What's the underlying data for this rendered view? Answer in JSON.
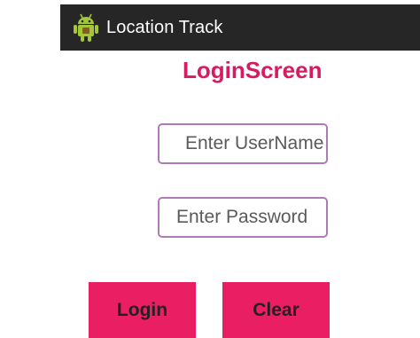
{
  "titlebar": {
    "app_title": "Location Track",
    "icon": "android-robot-icon",
    "background": "#262626"
  },
  "heading": {
    "text": "LoginScreen",
    "color": "#d81b60"
  },
  "form": {
    "username_placeholder": "Enter UserName",
    "password_placeholder": "Enter Password",
    "field_border_color": "#b07ab8"
  },
  "buttons": {
    "login_label": "Login",
    "clear_label": "Clear",
    "color": "#e91e63"
  }
}
